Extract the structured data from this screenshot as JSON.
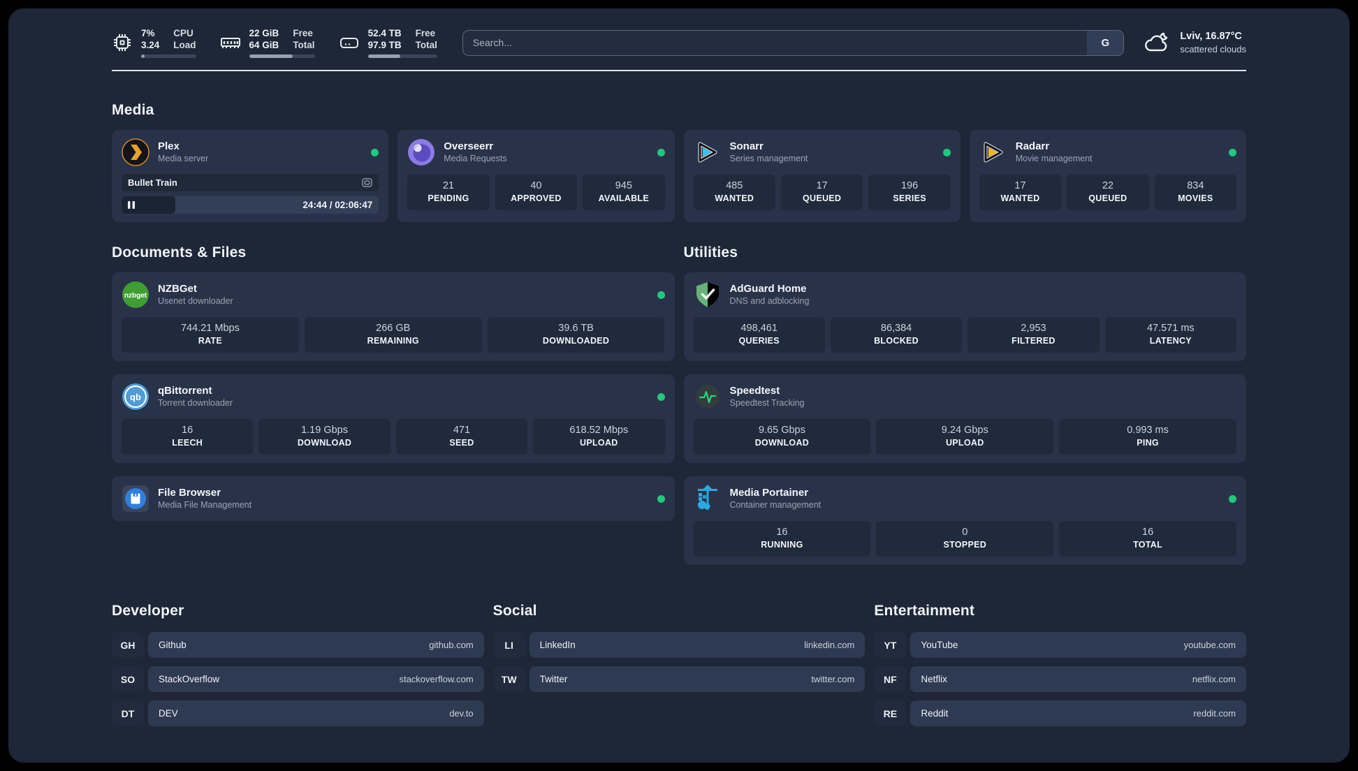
{
  "topbar": {
    "stats": [
      {
        "values": [
          "7%",
          "3.24"
        ],
        "labels": [
          "CPU",
          "Load"
        ],
        "progress_pct": 7
      },
      {
        "values": [
          "22 GiB",
          "64 GiB"
        ],
        "labels": [
          "Free",
          "Total"
        ],
        "progress_pct": 66
      },
      {
        "values": [
          "52.4 TB",
          "97.9 TB"
        ],
        "labels": [
          "Free",
          "Total"
        ],
        "progress_pct": 47
      }
    ],
    "search": {
      "placeholder": "Search...",
      "engine_button": "G"
    },
    "weather": {
      "line1": "Lviv, 16.87°C",
      "line2": "scattered clouds"
    }
  },
  "sections": {
    "media": "Media",
    "documents": "Documents & Files",
    "utilities": "Utilities",
    "developer": "Developer",
    "social": "Social",
    "entertainment": "Entertainment"
  },
  "apps": {
    "plex": {
      "name": "Plex",
      "description": "Media server",
      "status": "online",
      "now_playing": {
        "title": "Bullet Train",
        "time_display": "24:44 / 02:06:47",
        "progress_pct": 21
      }
    },
    "overseerr": {
      "name": "Overseerr",
      "description": "Media Requests",
      "status": "online",
      "stats": [
        {
          "value": "21",
          "label": "PENDING"
        },
        {
          "value": "40",
          "label": "APPROVED"
        },
        {
          "value": "945",
          "label": "AVAILABLE"
        }
      ]
    },
    "sonarr": {
      "name": "Sonarr",
      "description": "Series management",
      "status": "online",
      "stats": [
        {
          "value": "485",
          "label": "WANTED"
        },
        {
          "value": "17",
          "label": "QUEUED"
        },
        {
          "value": "196",
          "label": "SERIES"
        }
      ]
    },
    "radarr": {
      "name": "Radarr",
      "description": "Movie management",
      "status": "online",
      "stats": [
        {
          "value": "17",
          "label": "WANTED"
        },
        {
          "value": "22",
          "label": "QUEUED"
        },
        {
          "value": "834",
          "label": "MOVIES"
        }
      ]
    },
    "nzbget": {
      "name": "NZBGet",
      "description": "Usenet downloader",
      "status": "online",
      "stats": [
        {
          "value": "744.21 Mbps",
          "label": "RATE"
        },
        {
          "value": "266 GB",
          "label": "REMAINING"
        },
        {
          "value": "39.6 TB",
          "label": "DOWNLOADED"
        }
      ]
    },
    "qbittorrent": {
      "name": "qBittorrent",
      "description": "Torrent downloader",
      "status": "online",
      "stats": [
        {
          "value": "16",
          "label": "LEECH"
        },
        {
          "value": "1.19 Gbps",
          "label": "DOWNLOAD"
        },
        {
          "value": "471",
          "label": "SEED"
        },
        {
          "value": "618.52 Mbps",
          "label": "UPLOAD"
        }
      ]
    },
    "filebrowser": {
      "name": "File Browser",
      "description": "Media File Management",
      "status": "online"
    },
    "adguard": {
      "name": "AdGuard Home",
      "description": "DNS and adblocking",
      "stats": [
        {
          "value": "498,461",
          "label": "QUERIES"
        },
        {
          "value": "86,384",
          "label": "BLOCKED"
        },
        {
          "value": "2,953",
          "label": "FILTERED"
        },
        {
          "value": "47.571 ms",
          "label": "LATENCY"
        }
      ]
    },
    "speedtest": {
      "name": "Speedtest",
      "description": "Speedtest Tracking",
      "stats": [
        {
          "value": "9.65 Gbps",
          "label": "DOWNLOAD"
        },
        {
          "value": "9.24 Gbps",
          "label": "UPLOAD"
        },
        {
          "value": "0.993 ms",
          "label": "PING"
        }
      ]
    },
    "portainer": {
      "name": "Media Portainer",
      "description": "Container management",
      "status": "online",
      "stats": [
        {
          "value": "16",
          "label": "RUNNING"
        },
        {
          "value": "0",
          "label": "STOPPED"
        },
        {
          "value": "16",
          "label": "TOTAL"
        }
      ]
    }
  },
  "links": {
    "developer": [
      {
        "abbr": "GH",
        "name": "Github",
        "url": "github.com"
      },
      {
        "abbr": "SO",
        "name": "StackOverflow",
        "url": "stackoverflow.com"
      },
      {
        "abbr": "DT",
        "name": "DEV",
        "url": "dev.to"
      }
    ],
    "social": [
      {
        "abbr": "LI",
        "name": "LinkedIn",
        "url": "linkedin.com"
      },
      {
        "abbr": "TW",
        "name": "Twitter",
        "url": "twitter.com"
      }
    ],
    "entertainment": [
      {
        "abbr": "YT",
        "name": "YouTube",
        "url": "youtube.com"
      },
      {
        "abbr": "NF",
        "name": "Netflix",
        "url": "netflix.com"
      },
      {
        "abbr": "RE",
        "name": "Reddit",
        "url": "reddit.com"
      }
    ]
  },
  "colors": {
    "status_online": "#1fc97d",
    "page_background": "#1d2737",
    "card_background": "#283349"
  }
}
